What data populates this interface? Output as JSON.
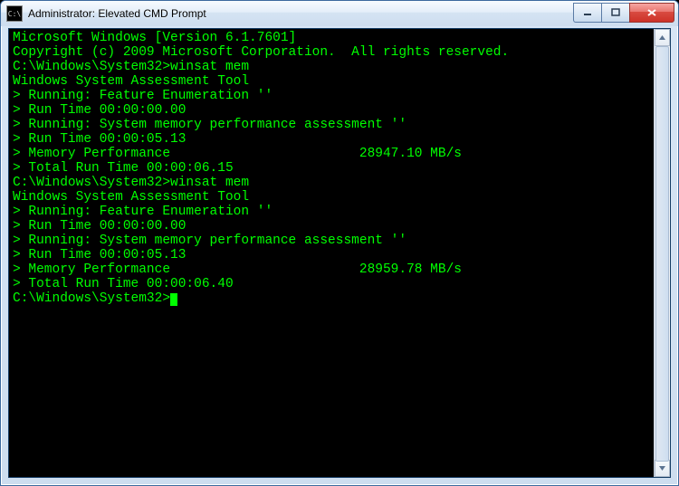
{
  "window": {
    "title": "Administrator: Elevated CMD Prompt",
    "icon_text": "C:\\"
  },
  "terminal": {
    "header1": "Microsoft Windows [Version 6.1.7601]",
    "header2": "Copyright (c) 2009 Microsoft Corporation.  All rights reserved.",
    "blank": "",
    "runs": [
      {
        "prompt": "C:\\Windows\\System32>",
        "command": "winsat mem",
        "tool_line": "Windows System Assessment Tool",
        "lines": [
          "> Running: Feature Enumeration ''",
          "> Run Time 00:00:00.00",
          "> Running: System memory performance assessment ''",
          "> Run Time 00:00:05.13",
          "> Memory Performance                        28947.10 MB/s",
          "> Total Run Time 00:00:06.15"
        ]
      },
      {
        "prompt": "C:\\Windows\\System32>",
        "command": "winsat mem",
        "tool_line": "Windows System Assessment Tool",
        "lines": [
          "> Running: Feature Enumeration ''",
          "> Run Time 00:00:00.00",
          "> Running: System memory performance assessment ''",
          "> Run Time 00:00:05.13",
          "> Memory Performance                        28959.78 MB/s",
          "> Total Run Time 00:00:06.40"
        ]
      }
    ],
    "final_prompt": "C:\\Windows\\System32>"
  }
}
